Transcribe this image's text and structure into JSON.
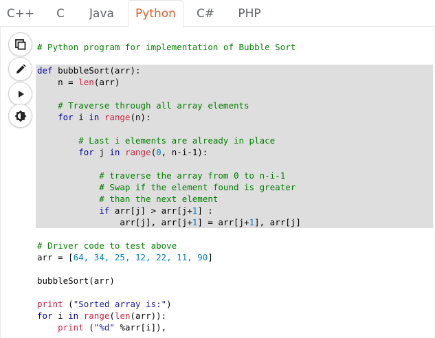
{
  "tabs": [
    {
      "label": "C++",
      "active": false
    },
    {
      "label": "C",
      "active": false
    },
    {
      "label": "Java",
      "active": false
    },
    {
      "label": "Python",
      "active": true
    },
    {
      "label": "C#",
      "active": false
    },
    {
      "label": "PHP",
      "active": false
    }
  ],
  "toolbar": {
    "icons": [
      "copy-icon",
      "edit-icon",
      "run-icon",
      "theme-icon"
    ]
  },
  "colors": {
    "active_tab": "#e05d2a",
    "comment": "#007f00",
    "keyword": "#0000a8",
    "builtin": "#d21f3c",
    "highlight": "#dedede"
  },
  "code": {
    "l1_comment": "# Python program for implementation of Bubble Sort",
    "l2_def": "def",
    "l2_rest": " bubbleSort(arr):",
    "l3_a": "    n = ",
    "l3_len": "len",
    "l3_b": "(arr)",
    "l5_comment": "    # Traverse through all array elements",
    "l6_for": "    for",
    "l6_i": " i ",
    "l6_in": "in",
    "l6_sp": " ",
    "l6_range": "range",
    "l6_rest": "(n):",
    "l8_comment": "        # Last i elements are already in place",
    "l9_for": "        for",
    "l9_j": " j ",
    "l9_in": "in",
    "l9_sp": " ",
    "l9_range": "range",
    "l9_open": "(",
    "l9_zero": "0",
    "l9_rest": ", n-i-1):",
    "l11_comment": "            # traverse the array from 0 to n-i-1",
    "l12_comment": "            # Swap if the element found is greater",
    "l13_comment": "            # than the next element",
    "l14_if": "            if",
    "l14_rest": " arr[j] > arr[j+",
    "l14_one": "1",
    "l14_end": "] :",
    "l15_a": "                arr[j], arr[j+",
    "l15_one": "1",
    "l15_b": "] = arr[j+",
    "l15_one2": "1",
    "l15_c": "], arr[j]",
    "l17_comment": "# Driver code to test above",
    "l18_a": "arr = [",
    "l18_nums": "64, 34, 25, 12, 22, 11, 90",
    "l18_b": "]",
    "l20": "bubbleSort(arr)",
    "l22_print": "print",
    "l22_sp": " (",
    "l22_str": "\"Sorted array is:\"",
    "l22_end": ")",
    "l23_for": "for",
    "l23_i": " i ",
    "l23_in": "in",
    "l23_sp": " ",
    "l23_range": "range",
    "l23_open": "(",
    "l23_len": "len",
    "l23_rest": "(arr)):",
    "l24_ind": "    ",
    "l24_print": "print",
    "l24_sp": " (",
    "l24_str": "\"%d\"",
    "l24_rest": " %arr[i]),"
  }
}
